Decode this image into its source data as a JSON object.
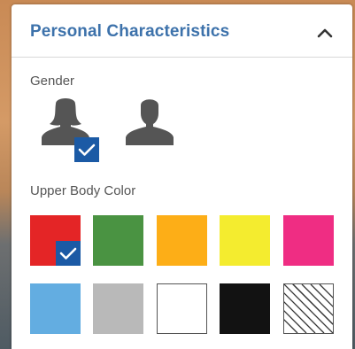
{
  "panel": {
    "title": "Personal Characteristics",
    "collapse_icon": "chevron-up-icon"
  },
  "gender": {
    "label": "Gender",
    "options": [
      {
        "name": "female",
        "icon": "female-person-icon",
        "selected": true
      },
      {
        "name": "male",
        "icon": "male-person-icon",
        "selected": false
      }
    ],
    "icon_color": "#555555",
    "check_color": "#1b5aa5"
  },
  "upper_body_color": {
    "label": "Upper Body Color",
    "swatches": [
      {
        "name": "red",
        "color": "#e42526",
        "selected": true
      },
      {
        "name": "green",
        "color": "#4a9342",
        "selected": false
      },
      {
        "name": "orange",
        "color": "#fdae17",
        "selected": false
      },
      {
        "name": "yellow",
        "color": "#f4ec2f",
        "selected": false
      },
      {
        "name": "pink",
        "color": "#ef2d83",
        "selected": false
      },
      {
        "name": "light-blue",
        "color": "#63ade1",
        "selected": false
      },
      {
        "name": "gray",
        "color": "#b9b9b9",
        "selected": false
      },
      {
        "name": "white",
        "color": "#ffffff",
        "selected": false
      },
      {
        "name": "black",
        "color": "#121212",
        "selected": false
      },
      {
        "name": "pattern",
        "color": "striped",
        "selected": false
      }
    ]
  },
  "colors": {
    "title": "#3d72ab",
    "label": "#555555",
    "divider": "#d8d8d8"
  }
}
